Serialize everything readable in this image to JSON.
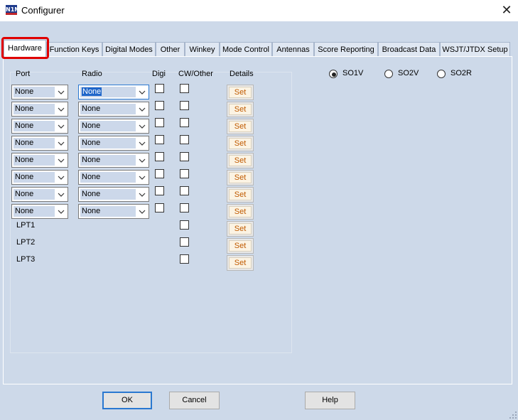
{
  "window": {
    "title": "Configurer",
    "app_icon": "N1MM",
    "close_glyph": "✕"
  },
  "tabs": [
    {
      "label": "Hardware",
      "active": true
    },
    {
      "label": "Function Keys"
    },
    {
      "label": "Digital Modes"
    },
    {
      "label": "Other"
    },
    {
      "label": "Winkey"
    },
    {
      "label": "Mode Control"
    },
    {
      "label": "Antennas"
    },
    {
      "label": "Score Reporting"
    },
    {
      "label": "Broadcast Data"
    },
    {
      "label": "WSJT/JTDX Setup"
    }
  ],
  "headers": {
    "port": "Port",
    "radio": "Radio",
    "digi": "Digi",
    "cw_other": "CW/Other",
    "details": "Details"
  },
  "rows": [
    {
      "port": "None",
      "radio": "None",
      "radio_selected": true,
      "digi": false,
      "cw": false,
      "set": "Set"
    },
    {
      "port": "None",
      "radio": "None",
      "digi": false,
      "cw": false,
      "set": "Set"
    },
    {
      "port": "None",
      "radio": "None",
      "digi": false,
      "cw": false,
      "set": "Set"
    },
    {
      "port": "None",
      "radio": "None",
      "digi": false,
      "cw": false,
      "set": "Set"
    },
    {
      "port": "None",
      "radio": "None",
      "digi": false,
      "cw": false,
      "set": "Set"
    },
    {
      "port": "None",
      "radio": "None",
      "digi": false,
      "cw": false,
      "set": "Set"
    },
    {
      "port": "None",
      "radio": "None",
      "digi": false,
      "cw": false,
      "set": "Set"
    },
    {
      "port": "None",
      "radio": "None",
      "digi": false,
      "cw": false,
      "set": "Set"
    }
  ],
  "lpt_rows": [
    {
      "label": "LPT1",
      "cw": false,
      "set": "Set"
    },
    {
      "label": "LPT2",
      "cw": false,
      "set": "Set"
    },
    {
      "label": "LPT3",
      "cw": false,
      "set": "Set"
    }
  ],
  "operation_mode": {
    "options": [
      {
        "label": "SO1V",
        "selected": true
      },
      {
        "label": "SO2V",
        "selected": false
      },
      {
        "label": "SO2R",
        "selected": false
      }
    ]
  },
  "buttons": {
    "ok": "OK",
    "cancel": "Cancel",
    "help": "Help"
  },
  "colors": {
    "window_bg": "#cdd9e9",
    "highlight": "#e00000",
    "set_text": "#c05a00",
    "selection": "#1f66c9"
  }
}
